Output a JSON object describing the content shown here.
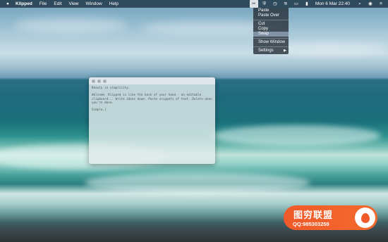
{
  "menubar": {
    "app_name": "Klipped",
    "menus": [
      "File",
      "Edit",
      "View",
      "Window",
      "Help"
    ],
    "status_icons": [
      "klipped-icon",
      "shield-icon",
      "clock-icon",
      "wifi-icon",
      "airplay-icon",
      "battery-icon"
    ],
    "clock": "Mon 6 Mar  22:40",
    "right_icons": [
      "search-icon",
      "user-icon",
      "list-icon"
    ]
  },
  "dropdown": {
    "items": [
      "Paste",
      "Paste Over",
      "Cut",
      "Copy",
      "Swap",
      "Show Window",
      "Settings"
    ],
    "highlighted": "Swap"
  },
  "window": {
    "heading": "Beauty in simplicity.",
    "body": "Welcome. Klipped is like the back of your hand - an editable clipboard... Write ideas down. Paste snippets of text. Delete when you're done.",
    "signoff": "Simple.|"
  },
  "watermark": {
    "title": "图穷联盟",
    "qq": "QQ:985303259"
  }
}
